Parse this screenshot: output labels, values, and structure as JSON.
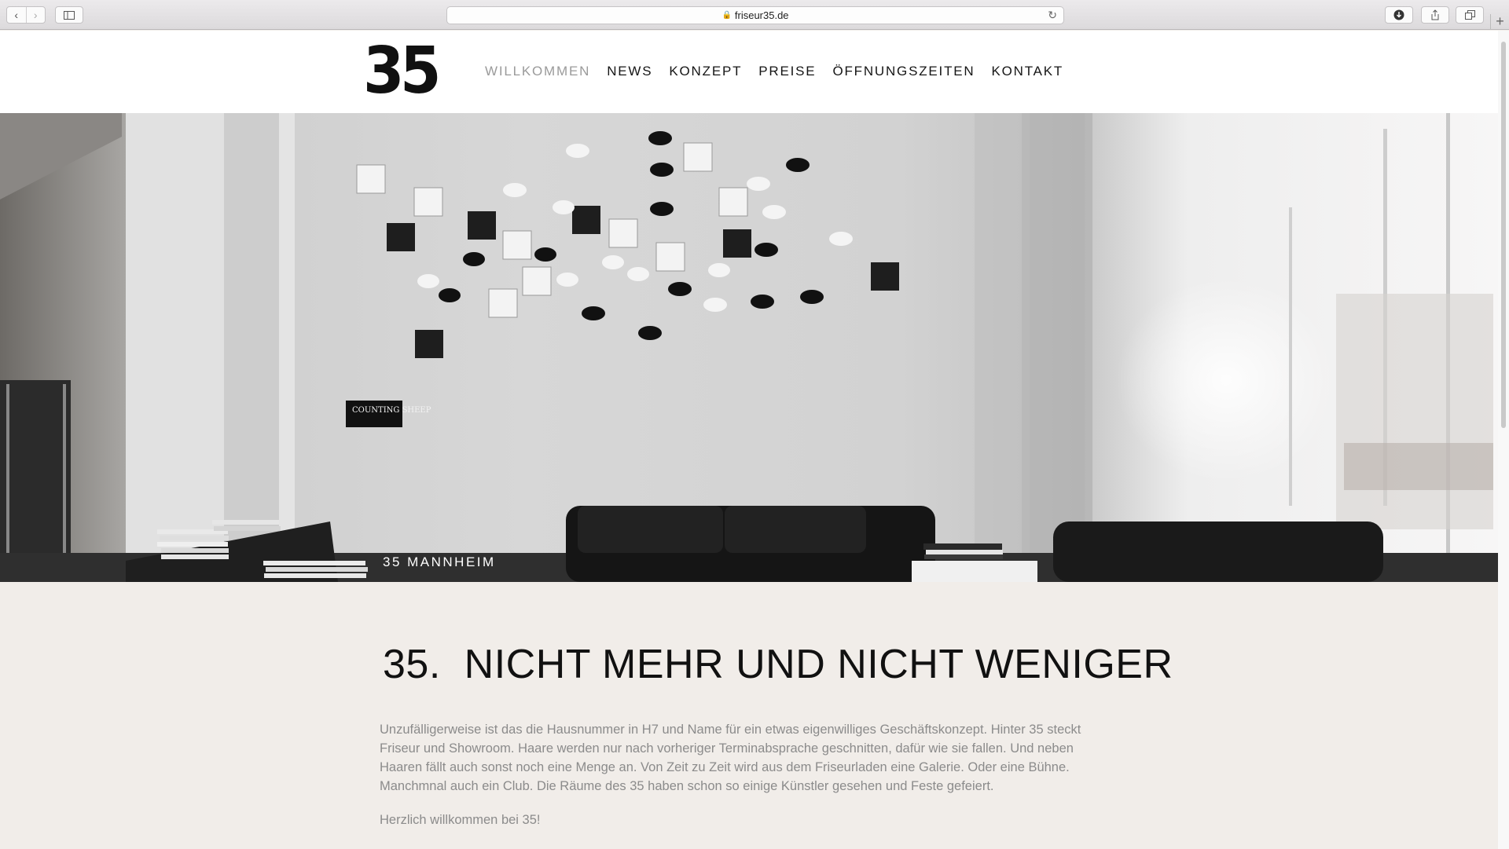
{
  "browser": {
    "url": "friseur35.de"
  },
  "site": {
    "logo_text": "35",
    "nav": [
      {
        "label": "WILLKOMMEN",
        "active": true
      },
      {
        "label": "NEWS",
        "active": false
      },
      {
        "label": "KONZEPT",
        "active": false
      },
      {
        "label": "PREISE",
        "active": false
      },
      {
        "label": "ÖFFNUNGSZEITEN",
        "active": false
      },
      {
        "label": "KONTAKT",
        "active": false
      }
    ]
  },
  "hero": {
    "caption": "35 MANNHEIM",
    "sign_text": "COUNTING SHEEP"
  },
  "content": {
    "headline": "35.  NICHT MEHR UND NICHT WENIGER",
    "intro": "Unzufälligerweise ist das die Hausnummer in H7 und Name für ein etwas eigenwilliges Geschäftskonzept. Hinter 35 steckt Friseur und Showroom. Haare werden nur nach vorheriger Terminabsprache geschnitten, dafür wie sie fallen. Und neben Haaren fällt auch sonst noch eine Menge an. Von Zeit zu Zeit wird aus dem Friseurladen eine Galerie. Oder eine Bühne. Manchmnal auch ein Club. Die Räume des 35 haben schon so einige Künstler gesehen und Feste gefeiert.",
    "welcome": "Herzlich willkommen bei 35!"
  },
  "colors": {
    "background": "#f1ede9",
    "header_bg": "#ffffff",
    "nav_active": "#9a9a9a",
    "text_dark": "#111111",
    "text_muted": "#8b8b8b"
  }
}
